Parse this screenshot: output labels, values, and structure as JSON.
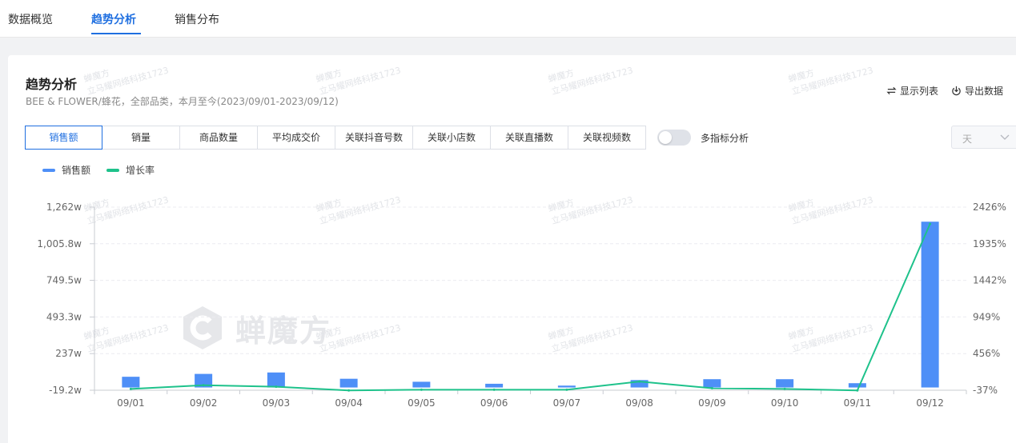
{
  "nav": {
    "tabs": [
      {
        "label": "数据概览"
      },
      {
        "label": "趋势分析"
      },
      {
        "label": "销售分布"
      }
    ]
  },
  "panel": {
    "title": "趋势分析",
    "subtitle": "BEE & FLOWER/蜂花，全部品类，本月至今(2023/09/01-2023/09/12)",
    "show_list": "显示列表",
    "export": "导出数据",
    "metric_tabs": [
      "销售额",
      "销量",
      "商品数量",
      "平均成交价",
      "关联抖音号数",
      "关联小店数",
      "关联直播数",
      "关联视频数"
    ],
    "multi_metric_label": "多指标分析",
    "multi_metric_on": false,
    "period": "天",
    "watermark_text": "蝉魔方",
    "watermark_small_1": "蝉魔方",
    "watermark_small_2": "立马耀网络科技1723"
  },
  "colors": {
    "accent": "#1f6fe0",
    "bar": "#4e8ff7",
    "line": "#1ec28b"
  },
  "chart_data": {
    "type": "bar",
    "categories": [
      "09/01",
      "09/02",
      "09/03",
      "09/04",
      "09/05",
      "09/06",
      "09/07",
      "09/08",
      "09/09",
      "09/10",
      "09/11",
      "09/12"
    ],
    "series": [
      {
        "name": "销售额",
        "type": "bar",
        "axis": "left",
        "values": [
          75,
          95,
          105,
          61,
          40,
          26,
          13,
          52,
          58,
          58,
          30,
          1160
        ]
      },
      {
        "name": "增长率",
        "type": "line",
        "axis": "right",
        "values": [
          -20,
          30,
          10,
          -40,
          -30,
          -30,
          -30,
          80,
          -10,
          -20,
          -40,
          2200
        ]
      }
    ],
    "left_ticks": [
      "-19.2w",
      "237w",
      "493.3w",
      "749.5w",
      "1,005.8w",
      "1,262w"
    ],
    "right_ticks": [
      "-37%",
      "456%",
      "949%",
      "1442%",
      "1935%",
      "2426%"
    ],
    "ylim_left": [
      -19.2,
      1262
    ],
    "ylim_right": [
      -37,
      2426
    ],
    "legend": "top-left",
    "grid": true
  }
}
